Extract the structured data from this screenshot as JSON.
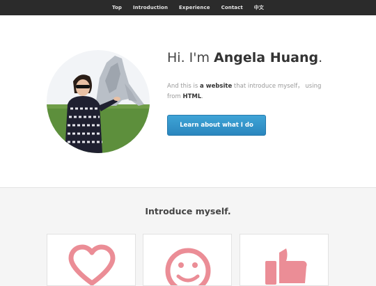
{
  "nav": {
    "items": [
      {
        "label": "Top"
      },
      {
        "label": "Introduction"
      },
      {
        "label": "Experience"
      },
      {
        "label": "Contact"
      },
      {
        "label": "中文"
      }
    ]
  },
  "hero": {
    "greeting": "Hi. I'm ",
    "name": "Angela Huang",
    "period": ".",
    "intro_pre": "And this is ",
    "intro_strong1": "a website",
    "intro_mid": " that introduce myself， using from ",
    "intro_strong2": "HTML",
    "intro_end": ".",
    "button_label": "Learn about what I do"
  },
  "section": {
    "title": "Introduce myself."
  },
  "cards": [
    {
      "icon": "heart-icon"
    },
    {
      "icon": "smiley-icon"
    },
    {
      "icon": "thumbs-up-icon"
    }
  ],
  "colors": {
    "topbar": "#2b2b2b",
    "accent": "#2f93c9",
    "icon": "#eb8d96"
  }
}
